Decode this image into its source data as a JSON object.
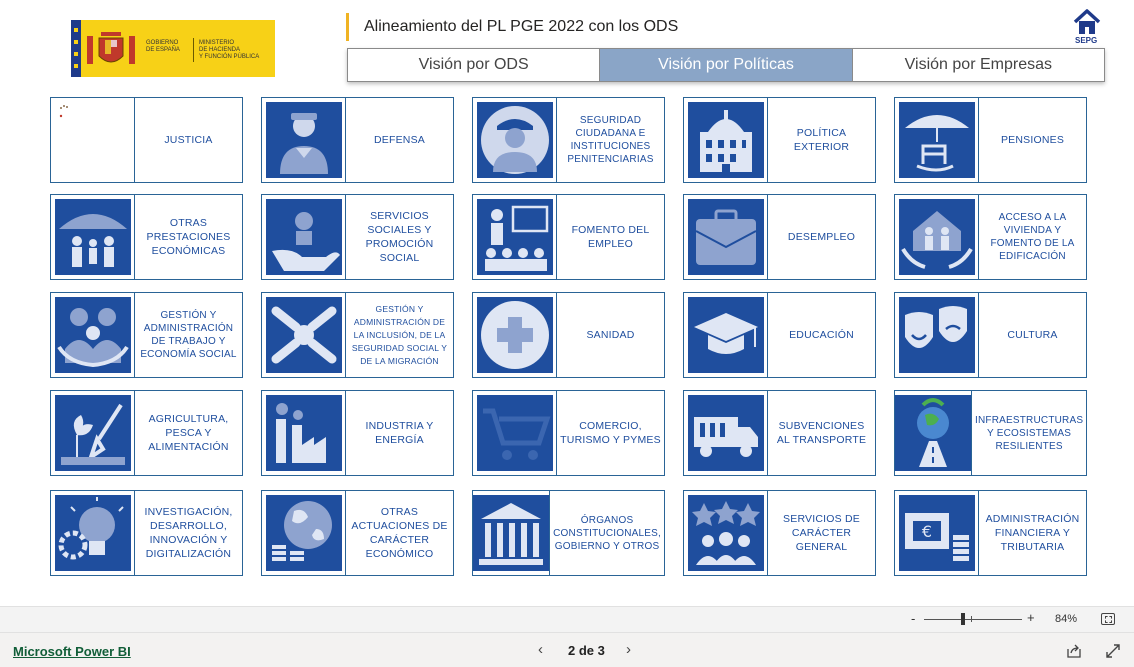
{
  "header": {
    "logo": {
      "gobierno": "GOBIERNO\nDE ESPAÑA",
      "ministerio": "MINISTERIO\nDE HACIENDA\nY FUNCIÓN PÚBLICA"
    },
    "title": "Alineamiento del PL PGE 2022 con los ODS",
    "home_label": "SEPG",
    "home_icon": "home-icon"
  },
  "tabs": [
    {
      "label": "Visión por ODS",
      "active": false
    },
    {
      "label": "Visión por Políticas",
      "active": true
    },
    {
      "label": "Visión por Empresas",
      "active": false
    }
  ],
  "cards": [
    {
      "label": "JUSTICIA",
      "icon": "justice-icon"
    },
    {
      "label": "DEFENSA",
      "icon": "soldier-icon"
    },
    {
      "label": "SEGURIDAD CIUDADANA E INSTITUCIONES PENITENCIARIAS",
      "icon": "police-officer-icon"
    },
    {
      "label": "POLÍTICA EXTERIOR",
      "icon": "government-building-icon"
    },
    {
      "label": "PENSIONES",
      "icon": "umbrella-rocking-chair-icon"
    },
    {
      "label": "OTRAS PRESTACIONES ECONÓMICAS",
      "icon": "umbrella-family-icon"
    },
    {
      "label": "SERVICIOS SOCIALES Y PROMOCIÓN SOCIAL",
      "icon": "hand-person-icon"
    },
    {
      "label": "FOMENTO DEL EMPLEO",
      "icon": "classroom-icon"
    },
    {
      "label": "DESEMPLEO",
      "icon": "briefcase-icon"
    },
    {
      "label": "ACCESO A LA VIVIENDA Y FOMENTO DE LA EDIFICACIÓN",
      "icon": "house-hands-icon"
    },
    {
      "label": "GESTIÓN Y ADMINISTRACIÓN DE TRABAJO Y ECONOMÍA SOCIAL",
      "icon": "family-hands-icon"
    },
    {
      "label": "GESTIÓN Y ADMINISTRACIÓN DE LA INCLUSIÓN, DE LA SEGURIDAD SOCIAL Y DE LA MIGRACIÓN",
      "icon": "joined-hands-icon"
    },
    {
      "label": "SANIDAD",
      "icon": "medical-cross-icon"
    },
    {
      "label": "EDUCACIÓN",
      "icon": "graduation-cap-icon"
    },
    {
      "label": "CULTURA",
      "icon": "theater-masks-icon"
    },
    {
      "label": "AGRICULTURA, PESCA Y ALIMENTACIÓN",
      "icon": "plant-shovel-icon"
    },
    {
      "label": "INDUSTRIA Y ENERGÍA",
      "icon": "factory-icon"
    },
    {
      "label": "COMERCIO, TURISMO Y PYMES",
      "icon": "shopping-cart-icon"
    },
    {
      "label": "SUBVENCIONES AL TRANSPORTE",
      "icon": "truck-icon"
    },
    {
      "label": "INFRAESTRUCTURAS Y ECOSISTEMAS RESILIENTES",
      "icon": "globe-road-icon"
    },
    {
      "label": "INVESTIGACIÓN, DESARROLLO, INNOVACIÓN Y DIGITALIZACIÓN",
      "icon": "lightbulb-gear-icon"
    },
    {
      "label": "OTRAS ACTUACIONES DE CARÁCTER ECONÓMICO",
      "icon": "globe-coins-icon"
    },
    {
      "label": "ÓRGANOS CONSTITUCIONALES, GOBIERNO Y OTROS",
      "icon": "institution-icon"
    },
    {
      "label": "SERVICIOS DE CARÁCTER GENERAL",
      "icon": "stars-people-icon"
    },
    {
      "label": "ADMINISTRACIÓN FINANCIERA Y TRIBUTARIA",
      "icon": "money-coins-icon"
    }
  ],
  "zoom": {
    "minus": "-",
    "plus": "+",
    "level": "84%"
  },
  "footer": {
    "powerbi_link": "Microsoft Power BI",
    "page_label": "2 de 3",
    "prev": "‹",
    "next": "›"
  },
  "colors": {
    "accent": "#1f4e9e",
    "active_tab": "#8aa5c7",
    "border": "#2a6496",
    "title_bar": "#f0b323"
  }
}
